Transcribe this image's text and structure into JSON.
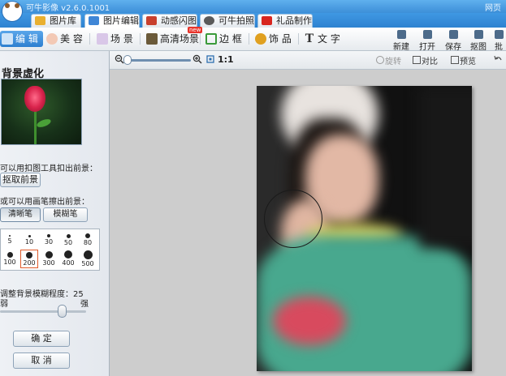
{
  "titlebar": {
    "title": "可牛影像 v2.6.0.1001",
    "right_text": "网页"
  },
  "main_tabs": [
    {
      "label": "图片库"
    },
    {
      "label": "图片编辑"
    },
    {
      "label": "动感闪图"
    },
    {
      "label": "可牛拍照"
    },
    {
      "label": "礼品制作"
    }
  ],
  "toolbar": {
    "items": [
      {
        "label": "编 辑"
      },
      {
        "label": "美 容"
      },
      {
        "label": "场 景"
      },
      {
        "label": "高清场景",
        "badge": "new"
      },
      {
        "label": "边 框"
      },
      {
        "label": "饰 品"
      },
      {
        "label": "文 字"
      }
    ],
    "right_buttons": [
      {
        "label": "新建"
      },
      {
        "label": "打开"
      },
      {
        "label": "保存"
      },
      {
        "label": "抠图"
      },
      {
        "label": "批处"
      }
    ]
  },
  "left_panel": {
    "title": "背景虚化",
    "instruction_1": "可以用扣图工具扣出前景：",
    "extract_button": "抠取前景",
    "instruction_2": "或可以用画笔擦出前景：",
    "brush_modes": [
      {
        "label": "清晰笔"
      },
      {
        "label": "模糊笔"
      }
    ],
    "brush_sizes": [
      {
        "label": "5"
      },
      {
        "label": "10"
      },
      {
        "label": "30"
      },
      {
        "label": "50"
      },
      {
        "label": "80"
      },
      {
        "label": "100"
      },
      {
        "label": "200"
      },
      {
        "label": "300"
      },
      {
        "label": "400"
      },
      {
        "label": "500"
      }
    ],
    "selected_brush_size": "200",
    "blur_label": "调整背景模糊程度：25",
    "blur_value": 25,
    "slider_min_label": "弱",
    "slider_max_label": "强",
    "confirm_button": "确 定",
    "cancel_button": "取 消"
  },
  "zoombar": {
    "zoom_text": "1:1",
    "rotate_label": "旋转",
    "compare_label": "对比",
    "preview_label": "预览"
  },
  "colors": {
    "title_bar": "#4aa0e8",
    "accent": "#2d7fd0",
    "canvas_bg": "#cdcdcd",
    "selected_brush_border": "#e05a2a"
  }
}
